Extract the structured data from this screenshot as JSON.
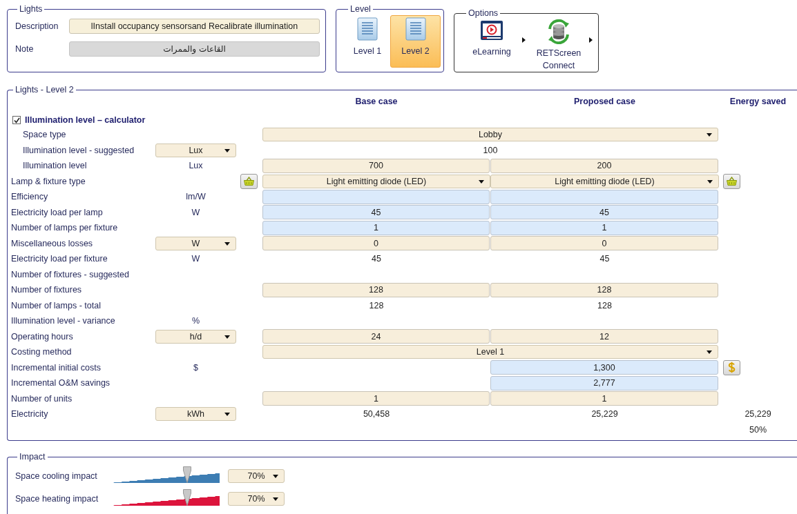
{
  "lights": {
    "legend": "Lights",
    "description": {
      "label": "Description",
      "value": "lInstall occupancy sensorsand Recalibrate illumination"
    },
    "note": {
      "label": "Note",
      "value": "القاعات والممرات"
    }
  },
  "level": {
    "legend": "Level",
    "items": [
      {
        "label": "Level 1",
        "selected": false
      },
      {
        "label": "Level 2",
        "selected": true
      }
    ]
  },
  "options": {
    "legend": "Options",
    "items": [
      {
        "label": "eLearning",
        "kind": "elearning"
      },
      {
        "label": "RETScreen Connect",
        "kind": "connect"
      }
    ]
  },
  "section": {
    "legend": "Lights - Level 2",
    "columns": [
      "Base case",
      "Proposed case",
      "Energy saved"
    ],
    "calculator": {
      "label": "Illumination level – calculator",
      "checked": true
    },
    "rows": [
      {
        "label": "Space type",
        "indented": true,
        "wide": {
          "kind": "dropdown",
          "text": "Lobby"
        }
      },
      {
        "label": "Illumination level - suggested",
        "indented": true,
        "unit": {
          "kind": "dropdown",
          "text": "Lux"
        },
        "wide": {
          "kind": "text",
          "text": "100"
        }
      },
      {
        "label": "Illumination level",
        "indented": true,
        "unit": {
          "kind": "text",
          "text": "Lux"
        },
        "base": {
          "kind": "input",
          "text": "700"
        },
        "proposed": {
          "kind": "input",
          "text": "200"
        }
      },
      {
        "label": "Lamp & fixture type",
        "indented": false,
        "left_button": {
          "kind": "basket"
        },
        "right_button": {
          "kind": "basket"
        },
        "base": {
          "kind": "dropdown",
          "text": "Light emitting diode (LED)"
        },
        "proposed": {
          "kind": "dropdown",
          "text": "Light emitting diode (LED)"
        }
      },
      {
        "label": "Efficiency",
        "indented": false,
        "unit": {
          "kind": "text",
          "text": "lm/W"
        },
        "base": {
          "kind": "lookup"
        },
        "proposed": {
          "kind": "lookup"
        }
      },
      {
        "label": "Electricity load per lamp",
        "indented": false,
        "unit": {
          "kind": "text",
          "text": "W"
        },
        "base": {
          "kind": "lookup",
          "text": "45"
        },
        "proposed": {
          "kind": "lookup",
          "text": "45"
        }
      },
      {
        "label": "Number of lamps per fixture",
        "indented": false,
        "base": {
          "kind": "lookup",
          "text": "1"
        },
        "proposed": {
          "kind": "lookup",
          "text": "1"
        }
      },
      {
        "label": "Miscellaneous losses",
        "indented": false,
        "unit": {
          "kind": "dropdown",
          "text": "W"
        },
        "base": {
          "kind": "input",
          "text": "0"
        },
        "proposed": {
          "kind": "input",
          "text": "0"
        }
      },
      {
        "label": "Electricity load per fixture",
        "indented": false,
        "unit": {
          "kind": "text",
          "text": "W"
        },
        "base": {
          "kind": "text",
          "text": "45"
        },
        "proposed": {
          "kind": "text",
          "text": "45"
        }
      },
      {
        "label": "Number of fixtures - suggested",
        "indented": false
      },
      {
        "label": "Number of fixtures",
        "indented": false,
        "base": {
          "kind": "input",
          "text": "128"
        },
        "proposed": {
          "kind": "input",
          "text": "128"
        }
      },
      {
        "label": "Number of lamps - total",
        "indented": false,
        "base": {
          "kind": "text",
          "text": "128"
        },
        "proposed": {
          "kind": "text",
          "text": "128"
        }
      },
      {
        "label": "Illumination level - variance",
        "indented": false,
        "unit": {
          "kind": "text",
          "text": "%"
        }
      },
      {
        "label": "Operating hours",
        "indented": false,
        "unit": {
          "kind": "dropdown",
          "text": "h/d"
        },
        "base": {
          "kind": "input",
          "text": "24"
        },
        "proposed": {
          "kind": "input",
          "text": "12"
        }
      },
      {
        "label": "Costing method",
        "indented": false,
        "wide": {
          "kind": "dropdown",
          "text": "Level 1"
        }
      },
      {
        "label": "Incremental initial costs",
        "indented": false,
        "unit": {
          "kind": "text",
          "text": "$"
        },
        "right_button": {
          "kind": "dollar"
        },
        "proposed": {
          "kind": "lookup",
          "text": "1,300"
        }
      },
      {
        "label": "Incremental O&M savings",
        "indented": false,
        "proposed": {
          "kind": "lookup",
          "text": "2,777"
        }
      },
      {
        "label": "Number of units",
        "indented": false,
        "base": {
          "kind": "input",
          "text": "1"
        },
        "proposed": {
          "kind": "input",
          "text": "1"
        }
      },
      {
        "label": "Electricity",
        "indented": false,
        "unit": {
          "kind": "dropdown",
          "text": "kWh"
        },
        "base": {
          "kind": "text",
          "text": "50,458"
        },
        "proposed": {
          "kind": "text",
          "text": "25,229"
        },
        "saved": "25,229"
      },
      {
        "saved": "50%"
      }
    ]
  },
  "impact": {
    "legend": "Impact",
    "items": [
      {
        "label": "Space cooling impact",
        "level": 0.7,
        "color": "#3d7db3",
        "value": "70%"
      },
      {
        "label": "Space heating impact",
        "level": 0.7,
        "color": "#dc143c",
        "value": "70%"
      }
    ]
  }
}
